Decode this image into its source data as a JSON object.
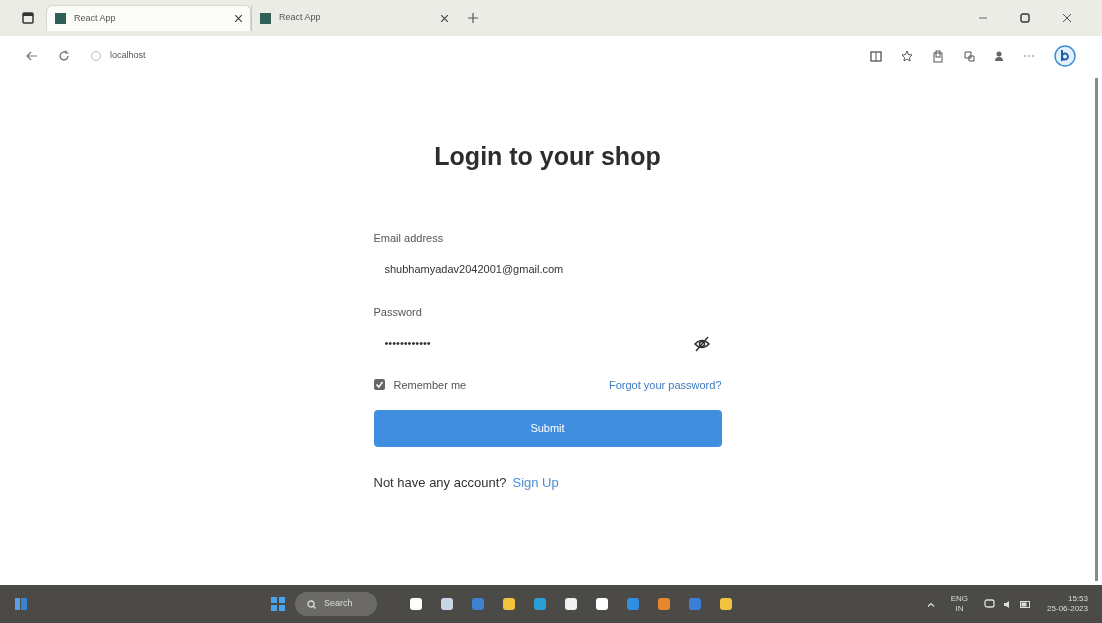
{
  "browser": {
    "tabs": [
      {
        "title": "React App",
        "selected": true
      },
      {
        "title": "React App",
        "selected": false
      }
    ],
    "address": "localhost"
  },
  "page": {
    "title": "Login to your shop",
    "fields": [
      {
        "label": "Email address",
        "value": "shubhamyadav2042001@gmail.com",
        "kind": "text"
      },
      {
        "label": "Password",
        "value": "••••••••••••",
        "kind": "password"
      }
    ],
    "remember": {
      "label": "Remember me",
      "checked": true
    },
    "forgot_link": "Forgot your password?",
    "submit": "Submit",
    "signup_prompt": "Not have any account?",
    "signup_link": "Sign Up"
  },
  "taskbar": {
    "search": "Search",
    "language": "ENG",
    "region": "IN",
    "time": "15:53",
    "date": "25-06-2023"
  }
}
